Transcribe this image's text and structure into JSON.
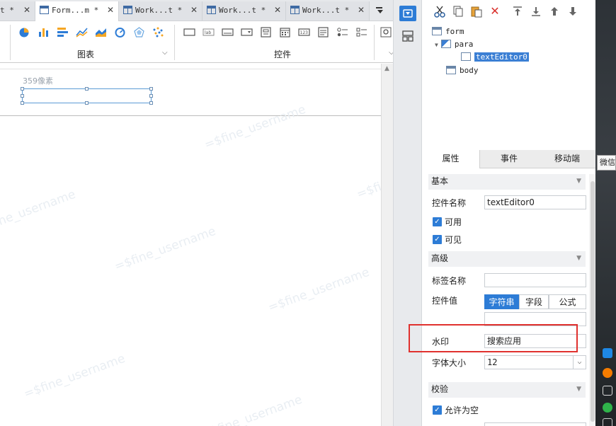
{
  "tabs": [
    {
      "label": "t *",
      "active": false
    },
    {
      "label": "Form...m *",
      "active": true
    },
    {
      "label": "Work...t *",
      "active": false
    },
    {
      "label": "Work...t *",
      "active": false
    },
    {
      "label": "Work...t *",
      "active": false
    }
  ],
  "ribbon": {
    "chart_group_label": "图表",
    "widget_group_label": "控件",
    "chart_icons": [
      "pie-chart-icon",
      "bar-chart-icon",
      "horizontal-bar-icon",
      "line-chart-icon",
      "area-chart-icon",
      "gauge-icon",
      "radar-icon",
      "scatter-icon"
    ],
    "widget_icons": [
      "button-widget-icon",
      "label-widget-icon",
      "text-editor-icon",
      "combobox-icon",
      "form-widget-icon",
      "date-widget-icon",
      "number-widget-icon",
      "textarea-icon",
      "radio-group-icon",
      "checkbox-group-icon"
    ]
  },
  "canvas": {
    "size_hint": "359像素",
    "watermark": "=$fine_username"
  },
  "tree": {
    "nodes": [
      {
        "label": "form",
        "selected": false
      },
      {
        "label": "para",
        "selected": false
      },
      {
        "label": "textEditor0",
        "selected": true
      },
      {
        "label": "body",
        "selected": false
      }
    ]
  },
  "panel_tabs": [
    "属性",
    "事件",
    "移动端"
  ],
  "props": {
    "basic_section": "基本",
    "widget_name_label": "控件名称",
    "widget_name_value": "textEditor0",
    "enabled_label": "可用",
    "visible_label": "可见",
    "advanced_section": "高级",
    "tag_name_label": "标签名称",
    "tag_name_value": "",
    "widget_value_label": "控件值",
    "value_modes": [
      "字符串",
      "字段",
      "公式"
    ],
    "widget_value_value": "",
    "watermark_label": "水印",
    "watermark_value": "搜索应用",
    "font_size_label": "字体大小",
    "font_size_value": "12",
    "validation_section": "校验",
    "allow_empty_label": "允许为空"
  },
  "tooltip_text": "微信",
  "colors": {
    "accent": "#2d7cd6",
    "highlight": "#e0312e",
    "selection": "#3b7fd4"
  }
}
